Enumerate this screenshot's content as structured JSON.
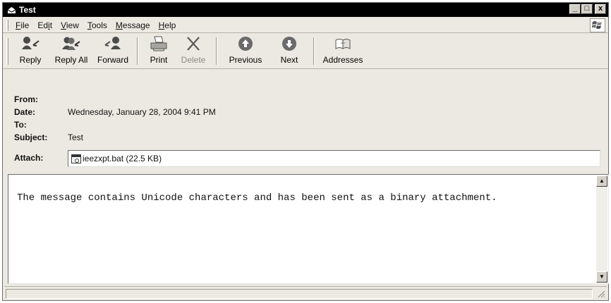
{
  "window": {
    "title": "Test",
    "controls": {
      "minimize": "_",
      "maximize": "□",
      "close": "x"
    }
  },
  "menu": [
    {
      "key": "file",
      "before": "",
      "accel": "F",
      "after": "ile"
    },
    {
      "key": "edit",
      "before": "Ed",
      "accel": "i",
      "after": "t"
    },
    {
      "key": "view",
      "before": "",
      "accel": "V",
      "after": "iew"
    },
    {
      "key": "tools",
      "before": "",
      "accel": "T",
      "after": "ools"
    },
    {
      "key": "message",
      "before": "",
      "accel": "M",
      "after": "essage"
    },
    {
      "key": "help",
      "before": "",
      "accel": "H",
      "after": "elp"
    }
  ],
  "toolbar": {
    "reply": "Reply",
    "reply_all": "Reply All",
    "forward": "Forward",
    "print": "Print",
    "delete": "Delete",
    "previous": "Previous",
    "next": "Next",
    "addresses": "Addresses"
  },
  "headers": {
    "from_label": "From:",
    "from_value": "",
    "date_label": "Date:",
    "date_value": "Wednesday, January 28, 2004 9:41 PM",
    "to_label": "To:",
    "to_value": "",
    "subject_label": "Subject:",
    "subject_value": "Test",
    "attach_label": "Attach:",
    "attachment": "ieezxpt.bat (22.5 KB)"
  },
  "body": {
    "text": "The message contains Unicode characters and has been sent as a binary attachment."
  },
  "colors": {
    "titlebar": "#000000",
    "chrome": "#ece9e2",
    "arrow_button": "#6a6a6a"
  }
}
